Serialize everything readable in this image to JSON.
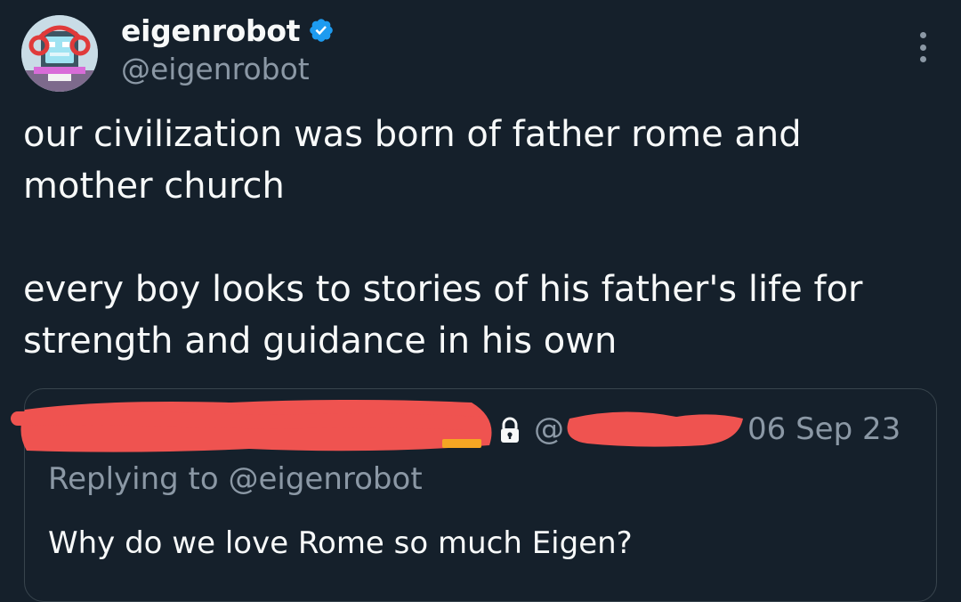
{
  "author": {
    "display_name": "eigenrobot",
    "handle": "@eigenrobot",
    "verified_icon": "verified-badge-icon",
    "avatar_icon": "robot-avatar"
  },
  "tweet": {
    "paragraphs": [
      "our civilization was born of father rome and mother church",
      "every boy looks to stories of his father's life for strength and guidance in his own"
    ]
  },
  "quoted_tweet": {
    "handle_prefix": "@",
    "date": "06 Sep 23",
    "replying_to": "Replying to @eigenrobot",
    "text": "Why do we love Rome so much Eigen?",
    "lock_icon": "lock-icon",
    "redaction_color": "#ef5350"
  },
  "colors": {
    "background": "#15202b",
    "primary_text": "#f7f9f9",
    "secondary_text": "#8b98a5",
    "verified_blue": "#1d9bf0",
    "border": "#38444d"
  }
}
